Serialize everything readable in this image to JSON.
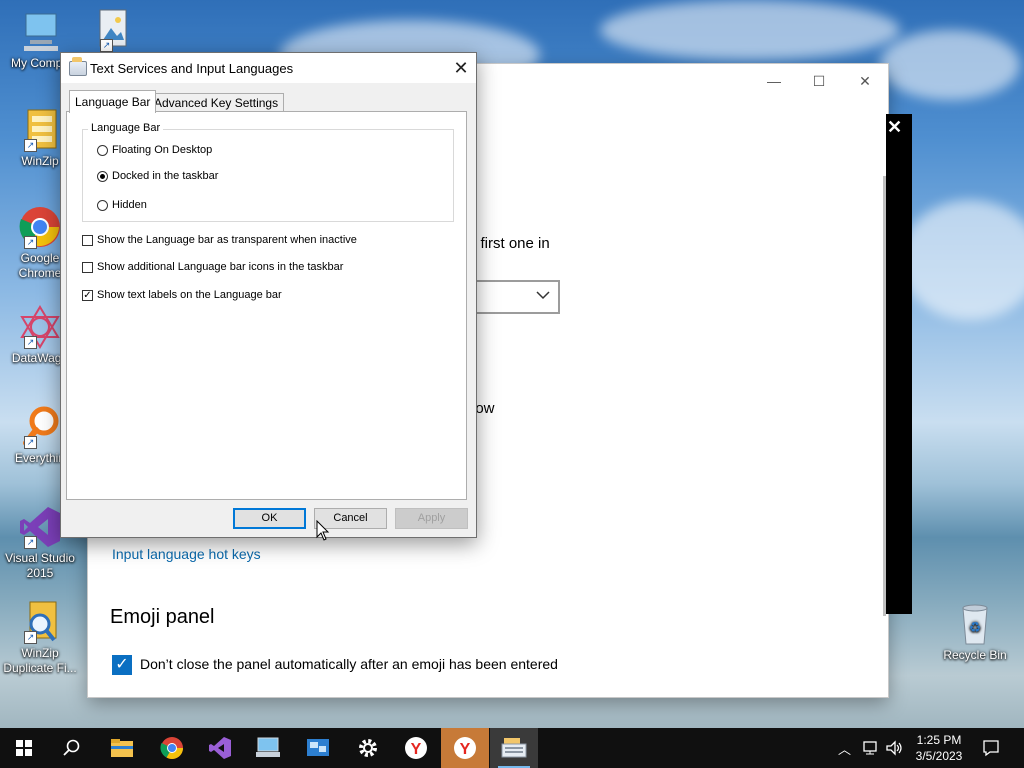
{
  "desktop": {
    "icons": [
      {
        "label": "My Compu",
        "name": "my-computer"
      },
      {
        "label": "WinZip",
        "name": "winzip"
      },
      {
        "label": "Google Chrome",
        "name": "google-chrome"
      },
      {
        "label": "DataWago",
        "name": "datawago"
      },
      {
        "label": "Everythin",
        "name": "everything"
      },
      {
        "label": "Visual Studio 2015",
        "name": "visual-studio"
      },
      {
        "label": "WinZip Duplicate Fi...",
        "name": "winzip-duplicate"
      },
      {
        "label": "Recycle Bin",
        "name": "recycle-bin"
      }
    ]
  },
  "settings_window": {
    "partial_text_1": "e first one in",
    "partial_text_2": "low",
    "hotkeys_link": "Input language hot keys",
    "emoji_heading": "Emoji panel",
    "emoji_checkbox_label": "Don’t close the panel automatically after an emoji has been entered",
    "minimize": "—",
    "maximize": "☐",
    "close": "✕"
  },
  "dialog": {
    "title": "Text Services and Input Languages",
    "close": "✕",
    "tabs": [
      {
        "label": "Language Bar",
        "active": true
      },
      {
        "label": "Advanced Key Settings",
        "active": false
      }
    ],
    "group_label": "Language Bar",
    "radios": [
      {
        "label": "Floating On Desktop",
        "checked": false
      },
      {
        "label": "Docked in the taskbar",
        "checked": true
      },
      {
        "label": "Hidden",
        "checked": false
      }
    ],
    "checkboxes": [
      {
        "label": "Show the Language bar as transparent when inactive",
        "checked": false
      },
      {
        "label": "Show additional Language bar icons in the taskbar",
        "checked": false
      },
      {
        "label": "Show text labels on the Language bar",
        "checked": true
      }
    ],
    "buttons": {
      "ok": "OK",
      "cancel": "Cancel",
      "apply": "Apply"
    }
  },
  "taskbar": {
    "time": "1:25 PM",
    "date": "3/5/2023"
  },
  "colors": {
    "accent": "#0078d7",
    "link": "#0a6aad",
    "taskbar": "#101010"
  }
}
